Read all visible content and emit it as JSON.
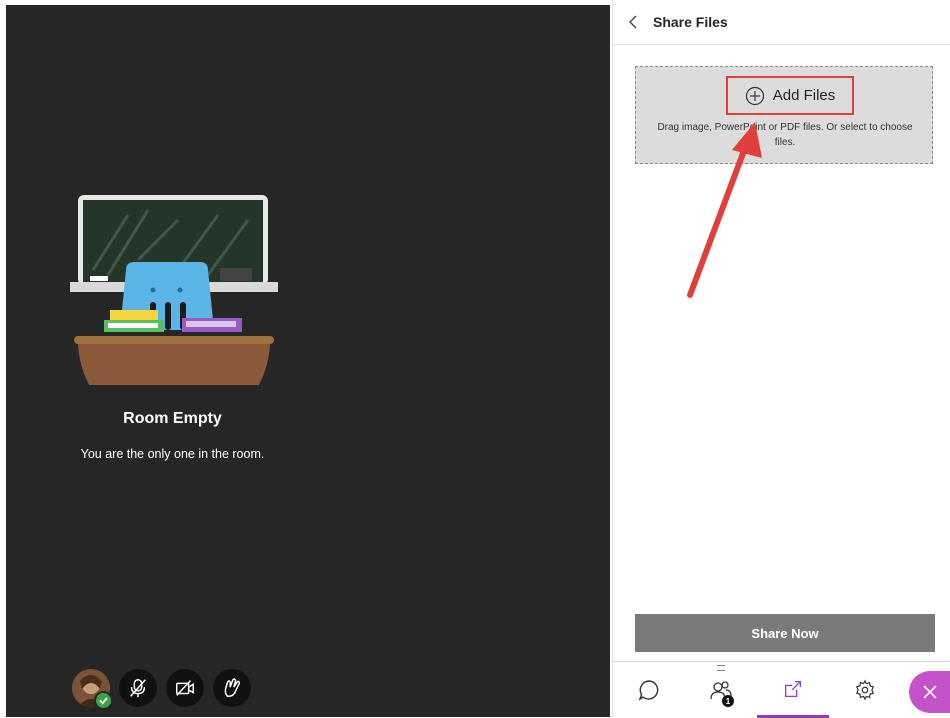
{
  "stage": {
    "title": "Room Empty",
    "subtitle": "You are the only one in the room."
  },
  "controls": [
    {
      "name": "user-avatar",
      "icon": "avatar-photo"
    },
    {
      "name": "microphone-toggle",
      "icon": "microphone-off-icon"
    },
    {
      "name": "camera-toggle",
      "icon": "camera-off-icon"
    },
    {
      "name": "raise-hand-toggle",
      "icon": "hand-icon"
    }
  ],
  "panel": {
    "title": "Share Files",
    "add_files_label": "Add Files",
    "drop_hint": "Drag image, PowerPoint or PDF files. Or select to choose files.",
    "share_now_label": "Share Now"
  },
  "tabs": [
    {
      "name": "chat",
      "icon": "chat-icon"
    },
    {
      "name": "attendees",
      "icon": "attendees-icon",
      "badge": "1"
    },
    {
      "name": "share-content",
      "icon": "share-icon",
      "active": true
    },
    {
      "name": "settings",
      "icon": "gear-icon"
    }
  ],
  "colors": {
    "stage_bg": "#262626",
    "accent": "#8e3fb5",
    "close_bg": "#c452c9",
    "highlight": "#e0403a",
    "share_button": "#7a7a7a"
  }
}
